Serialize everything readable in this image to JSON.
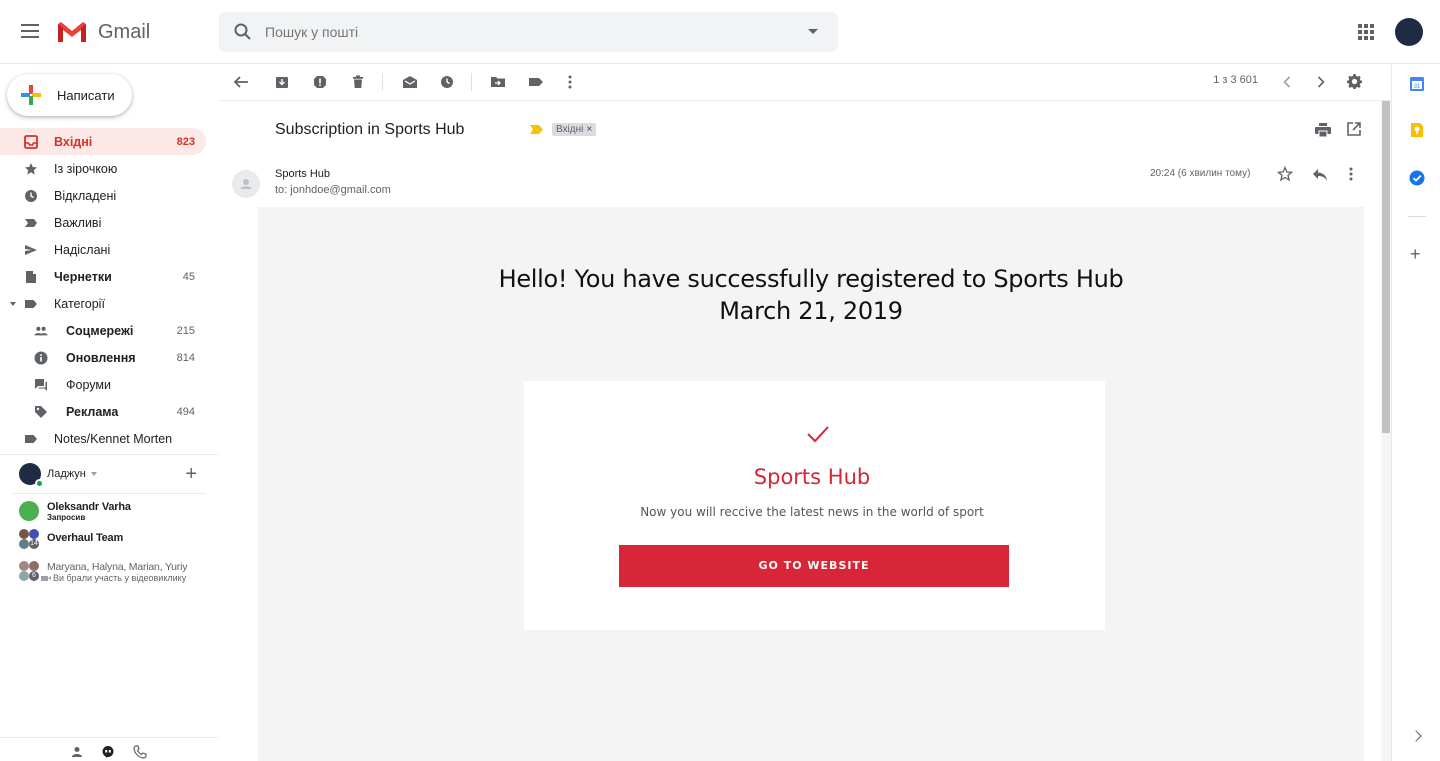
{
  "header": {
    "app_name": "Gmail",
    "search_placeholder": "Пошук у пошті"
  },
  "sidebar": {
    "compose_label": "Написати",
    "items": [
      {
        "label": "Вхідні",
        "count": "823",
        "icon": "inbox-icon",
        "active": true
      },
      {
        "label": "Із зірочкою",
        "count": "",
        "icon": "star-icon"
      },
      {
        "label": "Відкладені",
        "count": "",
        "icon": "clock-icon"
      },
      {
        "label": "Важливі",
        "count": "",
        "icon": "important-icon"
      },
      {
        "label": "Надіслані",
        "count": "",
        "icon": "send-icon"
      },
      {
        "label": "Чернетки",
        "count": "45",
        "icon": "draft-icon",
        "bold": true
      },
      {
        "label": "Категорії",
        "count": "",
        "icon": "label-icon"
      },
      {
        "label": "Соцмережі",
        "count": "215",
        "icon": "people-icon",
        "bold": true
      },
      {
        "label": "Оновлення",
        "count": "814",
        "icon": "info-icon",
        "bold": true
      },
      {
        "label": "Форуми",
        "count": "",
        "icon": "forum-icon"
      },
      {
        "label": "Реклама",
        "count": "494",
        "icon": "tag-icon",
        "bold": true
      },
      {
        "label": "Notes/Kennet Morten",
        "count": "",
        "icon": "label-icon"
      }
    ]
  },
  "hangouts": {
    "user_name": "Ладжун",
    "contacts": [
      {
        "name": "Oleksandr Varha",
        "sub": "Запросив"
      },
      {
        "name": "Overhaul Team",
        "sub": "",
        "badge": "14"
      },
      {
        "name": "Maryana, Halyna, Marian, Yuriy",
        "sub": "Ви брали участь у відеовиклику",
        "badge": "6"
      }
    ]
  },
  "toolbar": {
    "pager": "1 з 3 601"
  },
  "email": {
    "subject": "Subscription in Sports Hub",
    "label": "Вхідні",
    "label_close": "×",
    "sender": "Sports Hub",
    "to": "to: jonhdoe@gmail.com",
    "time": "20:24 (6 хвилин тому)",
    "body": {
      "title_line1": "Hello! You have successfully registered to Sports Hub",
      "title_line2": "March 21, 2019",
      "card_title": "Sports Hub",
      "card_text": "Now you will reccive the latest news in the world of sport",
      "cta": "GO TO WEBSITE"
    }
  },
  "colors": {
    "brand_red": "#d72638",
    "inbox_active_bg": "#fce8e6",
    "inbox_active_text": "#d93025"
  }
}
